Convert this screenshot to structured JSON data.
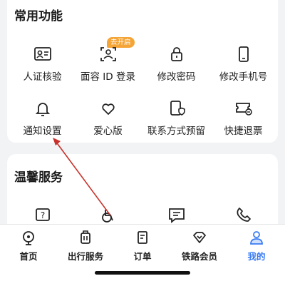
{
  "common_functions": {
    "title": "常用功能",
    "badge": "去开启",
    "items": [
      {
        "label": "人证核验",
        "icon": "id-verify-icon"
      },
      {
        "label": "面容 ID 登录",
        "icon": "face-id-icon"
      },
      {
        "label": "修改密码",
        "icon": "lock-icon"
      },
      {
        "label": "修改手机号",
        "icon": "phone-icon"
      },
      {
        "label": "通知设置",
        "icon": "bell-icon"
      },
      {
        "label": "爱心版",
        "icon": "heart-icon"
      },
      {
        "label": "联系方式预留",
        "icon": "contact-shield-icon"
      },
      {
        "label": "快捷退票",
        "icon": "ticket-refund-icon"
      }
    ]
  },
  "warm_services": {
    "title": "温馨服务",
    "items": [
      {
        "icon": "help-question-icon"
      },
      {
        "icon": "wheelchair-icon"
      },
      {
        "icon": "message-icon"
      },
      {
        "icon": "phone-call-icon"
      }
    ]
  },
  "tabbar": {
    "tabs": [
      {
        "label": "首页",
        "icon": "home-icon"
      },
      {
        "label": "出行服务",
        "icon": "luggage-icon"
      },
      {
        "label": "订单",
        "icon": "order-icon"
      },
      {
        "label": "铁路会员",
        "icon": "diamond-icon"
      },
      {
        "label": "我的",
        "icon": "profile-icon"
      }
    ],
    "active_index": 4
  },
  "colors": {
    "accent": "#3a7bf2",
    "badge": "#f5a436",
    "annotation_arrow": "#c8322c"
  }
}
